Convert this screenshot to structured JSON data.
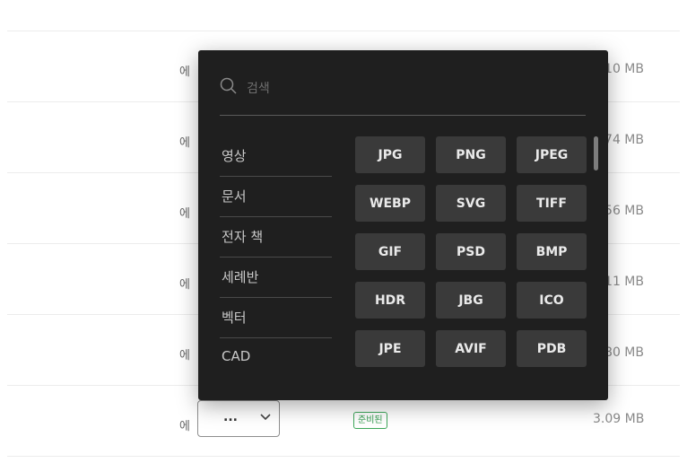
{
  "rows": [
    {
      "label": "",
      "size": ""
    },
    {
      "label": "에",
      "size": "10 MB"
    },
    {
      "label": "에",
      "size": "74 MB"
    },
    {
      "label": "에",
      "size": "56 MB"
    },
    {
      "label": "에",
      "size": "11 MB"
    },
    {
      "label": "에",
      "size": "80 MB"
    },
    {
      "label": "에",
      "size": "3.09 MB"
    }
  ],
  "select": {
    "value": "...",
    "icon": "chevron-down-icon"
  },
  "status_badge": "준비된",
  "popup": {
    "search_placeholder": "검색",
    "categories": [
      "영상",
      "문서",
      "전자 책",
      "세례반",
      "벡터",
      "CAD"
    ],
    "formats": [
      "JPG",
      "PNG",
      "JPEG",
      "WEBP",
      "SVG",
      "TIFF",
      "GIF",
      "PSD",
      "BMP",
      "HDR",
      "JBG",
      "ICO",
      "JPE",
      "AVIF",
      "PDB"
    ]
  },
  "colors": {
    "popup_bg": "#1f1f1f",
    "button_bg": "#3a3a3a",
    "badge_green": "#2f9a4b"
  }
}
